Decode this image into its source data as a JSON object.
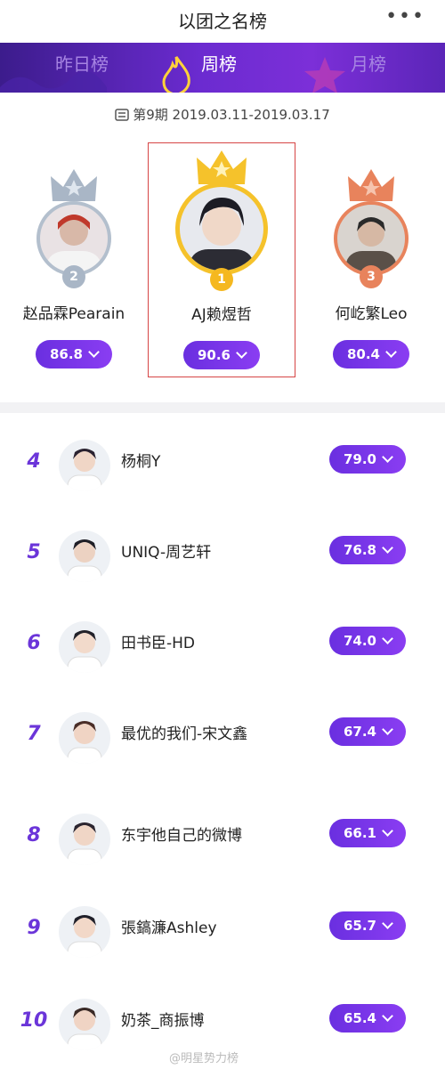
{
  "header": {
    "title": "以团之名榜",
    "more_label": "•••"
  },
  "tabs": [
    {
      "label": "昨日榜"
    },
    {
      "label": "周榜"
    },
    {
      "label": "月榜"
    }
  ],
  "period": "第9期 2019.03.11-2019.03.17",
  "podium": [
    {
      "rank": "2",
      "name": "赵品霖Pearain",
      "score": "86.8"
    },
    {
      "rank": "1",
      "name": "AJ赖煜哲",
      "score": "90.6"
    },
    {
      "rank": "3",
      "name": "何屹繁Leo",
      "score": "80.4"
    }
  ],
  "list": [
    {
      "rank": "4",
      "name": "杨桐Y",
      "score": "79.0"
    },
    {
      "rank": "5",
      "name": "UNIQ-周艺轩",
      "score": "76.8"
    },
    {
      "rank": "6",
      "name": "田书臣-HD",
      "score": "74.0"
    },
    {
      "rank": "7",
      "name": "最优的我们-宋文鑫",
      "score": "67.4"
    },
    {
      "rank": "8",
      "name": "东宇他自己的微博",
      "score": "66.1"
    },
    {
      "rank": "9",
      "name": "張鎬濂Ashley",
      "score": "65.7"
    },
    {
      "rank": "10",
      "name": "奶茶_商振博",
      "score": "65.4"
    }
  ],
  "watermark": "@明星势力榜",
  "colors": {
    "accent": "#7b35e6",
    "gold": "#f5c22b",
    "silver": "#a9b6c6",
    "bronze": "#e8835c"
  }
}
